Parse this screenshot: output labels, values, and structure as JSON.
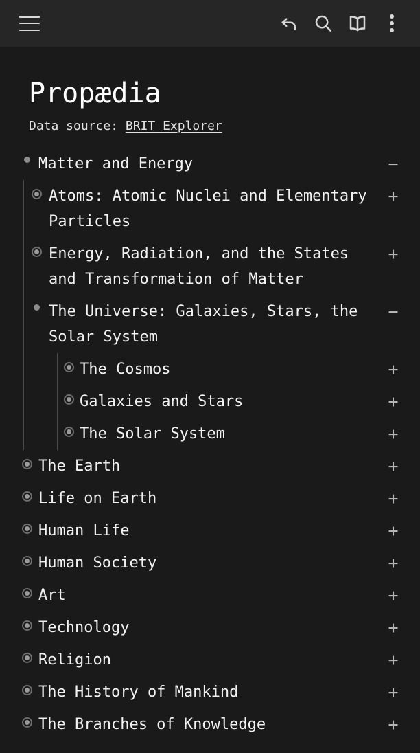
{
  "appbar": {
    "menu_icon": "hamburger-menu-icon",
    "undo_icon": "undo-arrow-icon",
    "search_icon": "search-icon",
    "book_icon": "open-book-icon",
    "overflow_icon": "three-dot-menu-icon"
  },
  "header": {
    "title": "Propædia",
    "source_prefix": "Data source: ",
    "source_link": "BRIT Explorer"
  },
  "markers": {
    "expanded": "filled-dot",
    "collapsed": "ring-dot",
    "toggle_expanded": "−",
    "toggle_collapsed": "+"
  },
  "colors": {
    "appbar_bg": "#262626",
    "page_bg": "#1a1a1a",
    "text": "#f2f2f2",
    "muted": "#b6b6b6",
    "guide_line": "#4a4a4a"
  },
  "tree": [
    {
      "label": "Matter and Energy",
      "state": "expanded",
      "toggle": "−",
      "children": [
        {
          "label": "Atoms: Atomic Nuclei and Elementary Particles",
          "state": "collapsed",
          "toggle": "+"
        },
        {
          "label": "Energy, Radiation, and the States and Transformation of Matter",
          "state": "collapsed",
          "toggle": "+"
        },
        {
          "label": "The Universe: Galaxies, Stars, the Solar System",
          "state": "expanded",
          "toggle": "−",
          "children": [
            {
              "label": "The Cosmos",
              "state": "collapsed",
              "toggle": "+"
            },
            {
              "label": "Galaxies and Stars",
              "state": "collapsed",
              "toggle": "+"
            },
            {
              "label": "The Solar System",
              "state": "collapsed",
              "toggle": "+"
            }
          ]
        }
      ]
    },
    {
      "label": "The Earth",
      "state": "collapsed",
      "toggle": "+"
    },
    {
      "label": "Life on Earth",
      "state": "collapsed",
      "toggle": "+"
    },
    {
      "label": "Human Life",
      "state": "collapsed",
      "toggle": "+"
    },
    {
      "label": "Human Society",
      "state": "collapsed",
      "toggle": "+"
    },
    {
      "label": "Art",
      "state": "collapsed",
      "toggle": "+"
    },
    {
      "label": "Technology",
      "state": "collapsed",
      "toggle": "+"
    },
    {
      "label": "Religion",
      "state": "collapsed",
      "toggle": "+"
    },
    {
      "label": "The History of Mankind",
      "state": "collapsed",
      "toggle": "+"
    },
    {
      "label": "The Branches of Knowledge",
      "state": "collapsed",
      "toggle": "+"
    }
  ]
}
